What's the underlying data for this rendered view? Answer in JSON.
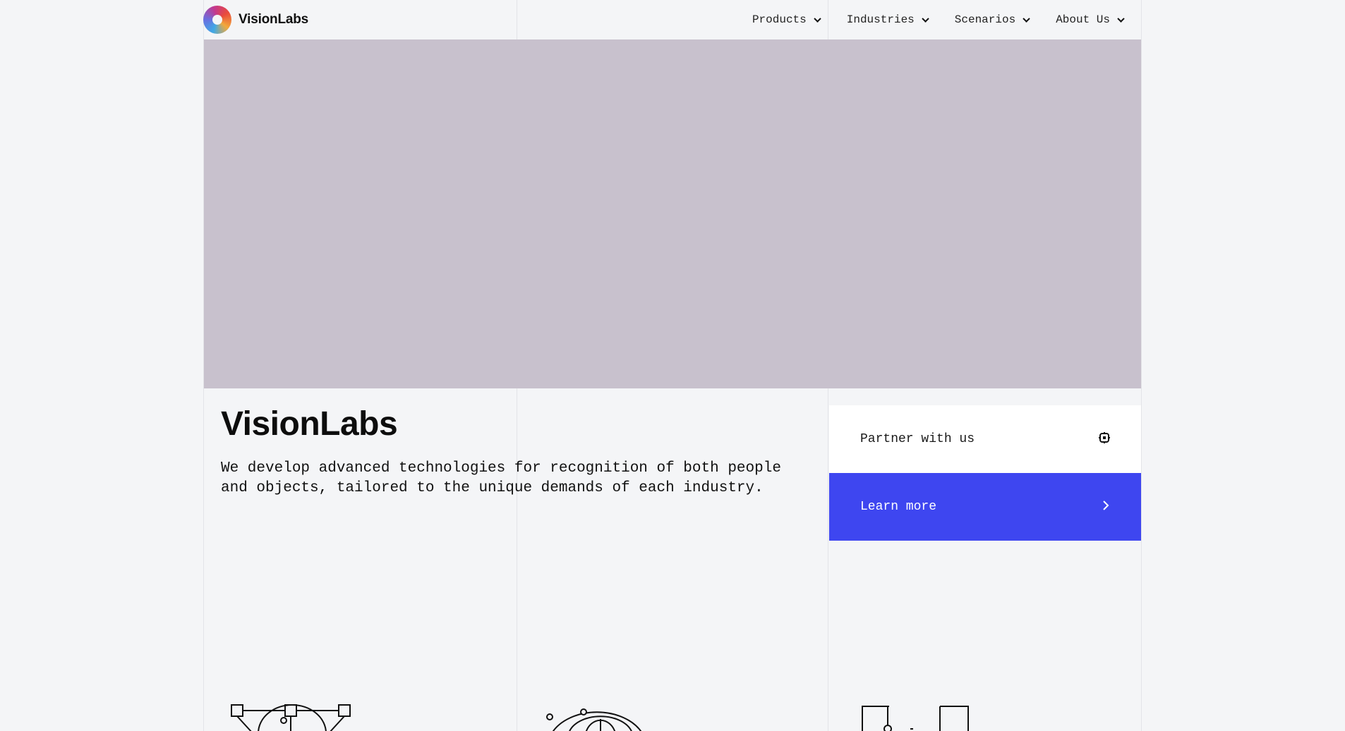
{
  "header": {
    "logo_text": "VisionLabs",
    "nav": [
      {
        "label": "Products"
      },
      {
        "label": "Industries"
      },
      {
        "label": "Scenarios"
      },
      {
        "label": "About Us"
      }
    ]
  },
  "main": {
    "title": "VisionLabs",
    "tagline": "We develop advanced technologies for recognition of both people and objects, tailored to the unique demands of each industry."
  },
  "cta": {
    "partner_label": "Partner with us",
    "partner_icon": "target-icon",
    "learn_label": "Learn more",
    "learn_icon": "chevron-right-icon"
  },
  "colors": {
    "background": "#f4f5f7",
    "hero": "#c8c1cd",
    "accent": "#3e46f0"
  }
}
